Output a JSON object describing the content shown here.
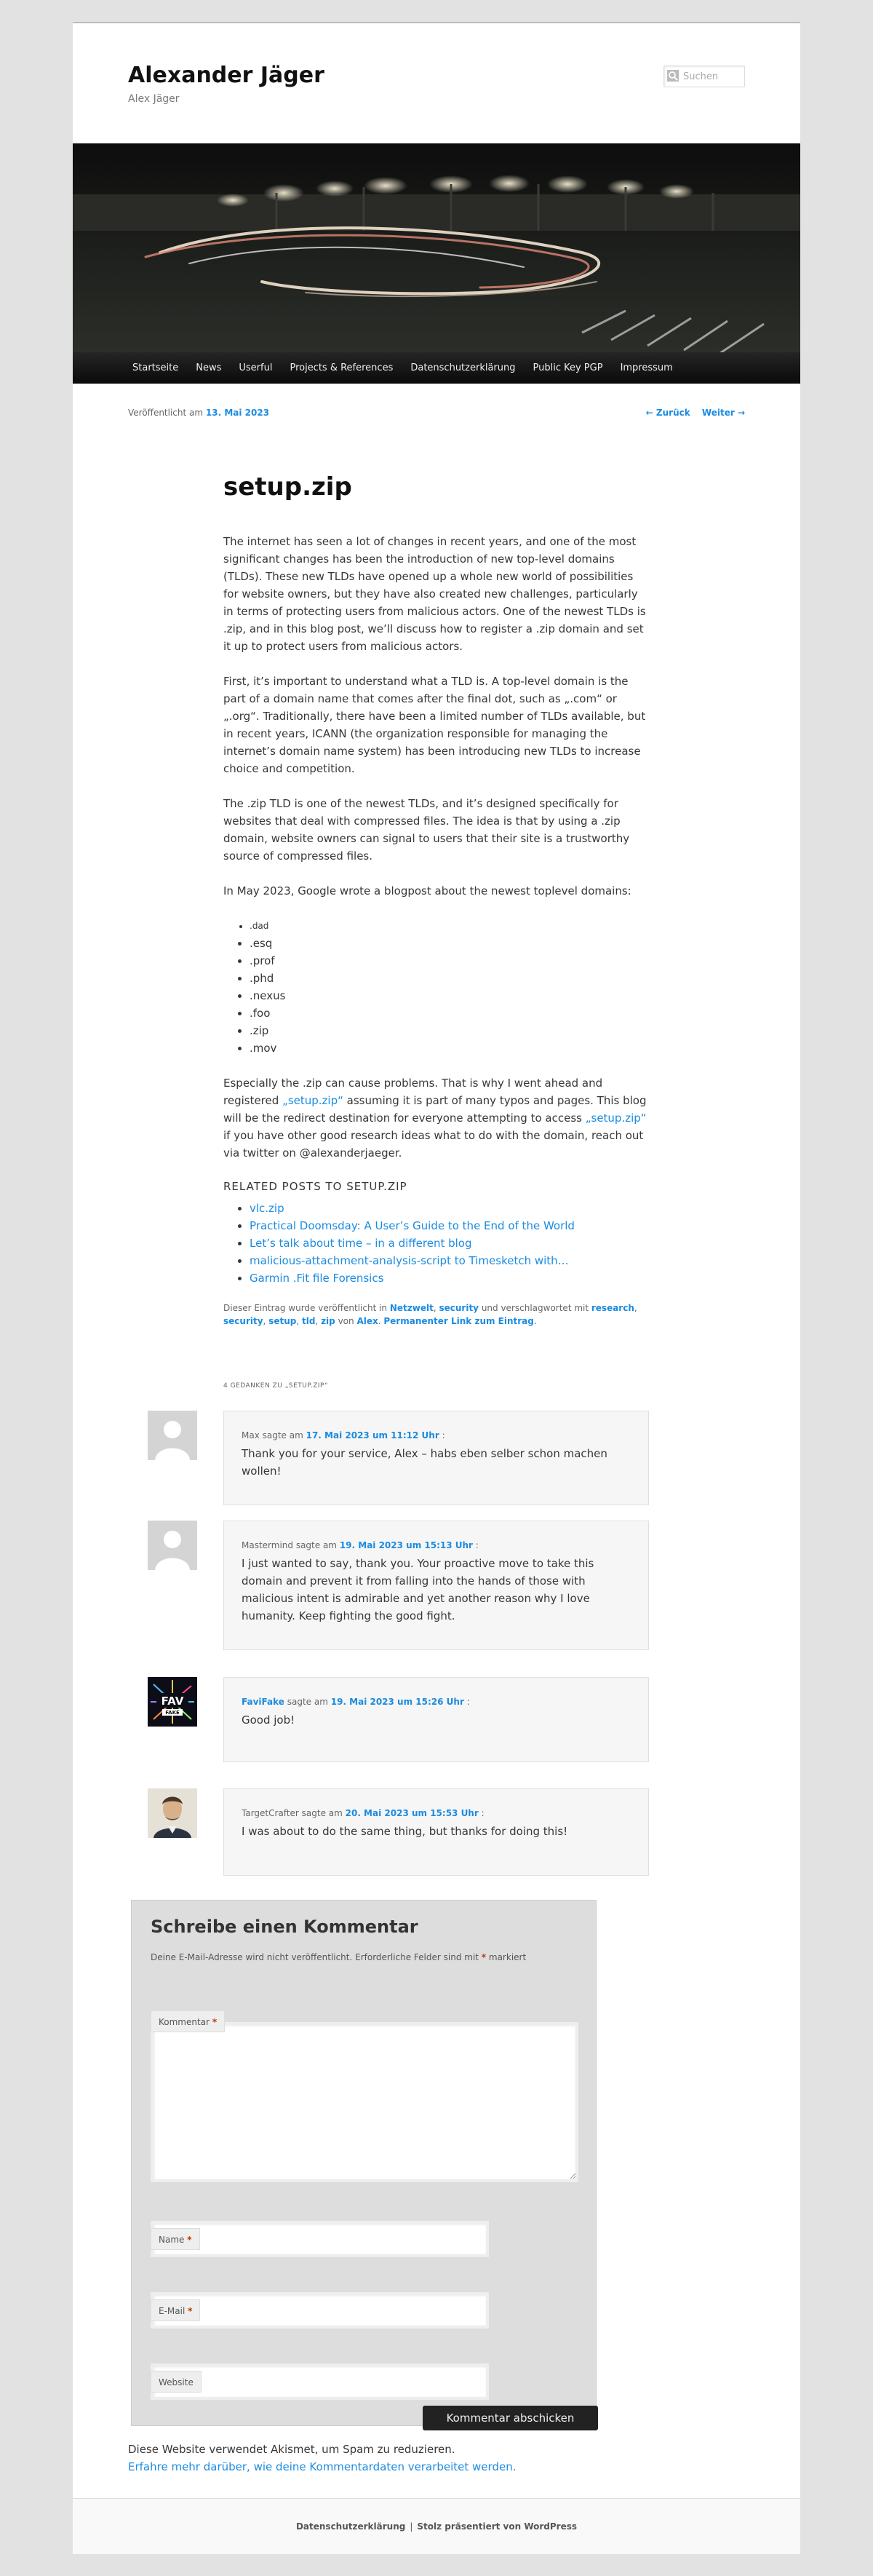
{
  "site": {
    "title": "Alexander Jäger",
    "description": "Alex Jäger"
  },
  "search": {
    "placeholder": "Suchen"
  },
  "nav": [
    "Startseite",
    "News",
    "Userful",
    "Projects & References",
    "Datenschutzerklärung",
    "Public Key PGP",
    "Impressum"
  ],
  "post_meta": {
    "prefix": "Veröffentlicht am ",
    "date": "13. Mai 2023",
    "prev": "← Zurück",
    "next": "Weiter →"
  },
  "post": {
    "title": "setup.zip",
    "p1": "The internet has seen a lot of changes in recent years, and one of the most significant changes has been the introduction of new top-level domains (TLDs). These new TLDs have opened up a whole new world of possibilities for website owners, but they have also created new challenges, particularly in terms of protecting users from malicious actors. One of the newest TLDs is .zip, and in this blog post, we’ll discuss how to register a .zip domain and set it up to protect users from malicious actors.",
    "p2": "First, it’s important to understand what a TLD is. A top-level domain is the part of a domain name that comes after the final dot, such as „.com“ or „.org“. Traditionally, there have been a limited number of TLDs available, but in recent years, ICANN (the organization responsible for managing the internet’s domain name system) has been introducing new TLDs to increase choice and competition.",
    "p3": "The .zip TLD is one of the newest TLDs, and it’s designed specifically for websites that deal with compressed files. The idea is that by using a .zip domain, website owners can signal to users that their site is a trustworthy source of compressed files.",
    "p4": "In May 2023, Google wrote a blogpost about the newest toplevel domains:",
    "tlds": [
      ".dad",
      ".esq",
      ".prof",
      ".phd",
      ".nexus",
      ".foo",
      ".zip",
      ".mov"
    ],
    "p5_a": "Especially the .zip can cause problems. That is why I went ahead and registered ",
    "p5_link1": "„setup.zip“",
    "p5_b": " assuming it is part of many typos and pages. This blog will be the redirect destination for everyone attempting to access ",
    "p5_link2": "„setup.zip“",
    "p5_c": " if you have other good research ideas what to do with the domain, reach out via twitter on @alexanderjaeger."
  },
  "related": {
    "title": "Related posts to setup.zip",
    "items": [
      "vlc.zip",
      "Practical Doomsday: A User’s Guide to the End of the World",
      "Let’s talk about time – in a different blog",
      "malicious-attachment-analysis-script to Timesketch with…",
      "Garmin .Fit file Forensics"
    ]
  },
  "entry_footer": {
    "t1": "Dieser Eintrag wurde veröffentlicht in ",
    "cat1": "Netzwelt",
    "cat2": "security",
    "t2": " und verschlagwortet mit ",
    "tag1": "research",
    "tag2": "security",
    "tag3": "setup",
    "tag4": "tld",
    "tag5": "zip",
    "t3": " von ",
    "author": "Alex",
    "permalink": "Permanenter Link zum Eintrag"
  },
  "comments_title": "4 Gedanken zu „setup.zip“",
  "comments": [
    {
      "author": "Max",
      "says": " sagte am ",
      "date": "17. Mai 2023 um 11:12 Uhr",
      "text": "Thank you for your service, Alex – habs eben selber schon machen wollen!"
    },
    {
      "author": "Mastermind",
      "says": " sagte am ",
      "date": "19. Mai 2023 um 15:13 Uhr",
      "text": "I just wanted to say, thank you. Your proactive move to take this domain and prevent it from falling into the hands of those with malicious intent is admirable and yet another reason why I love humanity. Keep fighting the good fight."
    },
    {
      "author": "FaviFake",
      "says": " sagte am ",
      "date": "19. Mai 2023 um 15:26 Uhr",
      "text": "Good job!"
    },
    {
      "author": "TargetCrafter",
      "says": " sagte am ",
      "date": "20. Mai 2023 um 15:53 Uhr",
      "text": "I was about to do the same thing, but thanks for doing this!"
    }
  ],
  "avatar_favi_text": "FAV\nFAKE",
  "respond": {
    "title": "Schreibe einen Kommentar",
    "notes": "Deine E-Mail-Adresse wird nicht veröffentlicht. Erforderliche Felder sind mit ",
    "notes_end": " markiert",
    "required_mark": "*",
    "comment_label": "Kommentar",
    "name_label": "Name",
    "email_label": "E-Mail",
    "website_label": "Website",
    "submit": "Kommentar abschicken"
  },
  "akismet": {
    "line1": "Diese Website verwendet Akismet, um Spam zu reduzieren.",
    "line2": "Erfahre mehr darüber, wie deine Kommentardaten verarbeitet werden."
  },
  "colophon": {
    "privacy": "Datenschutzerklärung",
    "sep": "|",
    "powered": "Stolz präsentiert von WordPress"
  },
  "colors": {
    "link": "#1b8be0",
    "required": "#bd3500",
    "nav_bg": "#111111"
  }
}
